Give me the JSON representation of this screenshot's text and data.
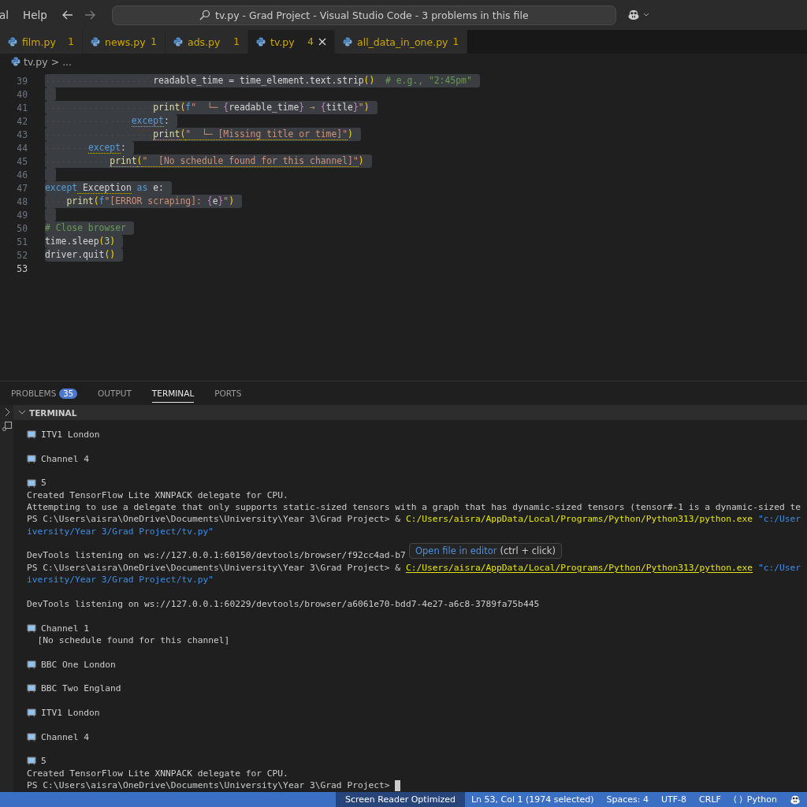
{
  "menu": [
    "al",
    "Help"
  ],
  "command_center": {
    "title": "tv.py - Grad Project - Visual Studio Code - 3 problems in this file"
  },
  "tabs": [
    {
      "label": "film.py",
      "problems": "1",
      "selected": false
    },
    {
      "label": "news.py",
      "problems": "1",
      "selected": false
    },
    {
      "label": "ads.py",
      "problems": "1",
      "selected": false
    },
    {
      "label": "tv.py",
      "problems": "4",
      "selected": true
    },
    {
      "label": "all_data_in_one.py",
      "problems": "1",
      "selected": false
    }
  ],
  "breadcrumb": {
    "file": "tv.py",
    "sep": ">",
    "rest": "..."
  },
  "editor": {
    "lines": [
      {
        "number": "39",
        "selected": true,
        "tokens": [
          {
            "kind": "plain",
            "text": "                    readable_time = time_element.text.strip"
          },
          {
            "kind": "paren",
            "text": "()"
          },
          {
            "kind": "comment",
            "text": "  # e.g., \"2:45pm\""
          }
        ]
      },
      {
        "number": "40",
        "selected": true
      },
      {
        "number": "41",
        "selected": true,
        "tokens": [
          {
            "kind": "func",
            "text": "                    print"
          },
          {
            "kind": "paren",
            "text": "("
          },
          {
            "kind": "keyword",
            "text": "f"
          },
          {
            "kind": "string",
            "text": "\"  └─ "
          },
          {
            "kind": "brace",
            "text": "{"
          },
          {
            "kind": "plain",
            "text": "readable_time"
          },
          {
            "kind": "brace",
            "text": "}"
          },
          {
            "kind": "string",
            "text": " → "
          },
          {
            "kind": "brace",
            "text": "{"
          },
          {
            "kind": "plain",
            "text": "title"
          },
          {
            "kind": "brace",
            "text": "}"
          },
          {
            "kind": "string",
            "text": "\""
          },
          {
            "kind": "paren",
            "text": ")"
          }
        ]
      },
      {
        "number": "42",
        "selected": true,
        "tokens": [
          {
            "kind": "keyword",
            "text": "                except",
            "warn": true
          },
          {
            "kind": "plain",
            "text": ":"
          }
        ]
      },
      {
        "number": "43",
        "selected": true,
        "tokens": [
          {
            "kind": "func",
            "text": "                    print",
            "warn": true
          },
          {
            "kind": "paren",
            "text": "(",
            "warn": true
          },
          {
            "kind": "string",
            "text": "\"  └─ [Missing title or time]\"",
            "warn": true
          },
          {
            "kind": "paren",
            "text": ")"
          }
        ]
      },
      {
        "number": "44",
        "selected": true,
        "tokens": [
          {
            "kind": "keyword",
            "text": "        except",
            "warn": true
          },
          {
            "kind": "plain",
            "text": ":"
          }
        ]
      },
      {
        "number": "45",
        "selected": true,
        "tokens": [
          {
            "kind": "func",
            "text": "            print",
            "warn": true
          },
          {
            "kind": "paren",
            "text": "(",
            "warn": true
          },
          {
            "kind": "string",
            "text": "\"  [No schedule found for this channel]\"",
            "warn": true
          },
          {
            "kind": "paren",
            "text": ")"
          }
        ]
      },
      {
        "number": "46",
        "selected": true
      },
      {
        "number": "47",
        "selected": true,
        "tokens": [
          {
            "kind": "keyword",
            "text": "except"
          },
          {
            "kind": "plain",
            "text": " Exception",
            "warn": true
          },
          {
            "kind": "keyword",
            "text": " as"
          },
          {
            "kind": "plain",
            "text": " e:"
          }
        ]
      },
      {
        "number": "48",
        "selected": true,
        "tokens": [
          {
            "kind": "func",
            "text": "    print"
          },
          {
            "kind": "paren",
            "text": "("
          },
          {
            "kind": "keyword",
            "text": "f"
          },
          {
            "kind": "string",
            "text": "\"[ERROR scraping]: "
          },
          {
            "kind": "brace",
            "text": "{"
          },
          {
            "kind": "plain",
            "text": "e"
          },
          {
            "kind": "brace",
            "text": "}"
          },
          {
            "kind": "string",
            "text": "\""
          },
          {
            "kind": "paren",
            "text": ")"
          }
        ]
      },
      {
        "number": "49",
        "selected": true
      },
      {
        "number": "50",
        "selected": true,
        "tokens": [
          {
            "kind": "comment",
            "text": "# Close browser"
          }
        ]
      },
      {
        "number": "51",
        "selected": true,
        "tokens": [
          {
            "kind": "plain",
            "text": "time.sleep"
          },
          {
            "kind": "paren",
            "text": "("
          },
          {
            "kind": "number",
            "text": "3"
          },
          {
            "kind": "paren",
            "text": ")"
          }
        ]
      },
      {
        "number": "52",
        "selected": true,
        "tokens": [
          {
            "kind": "plain",
            "text": "driver.quit"
          },
          {
            "kind": "paren",
            "text": "()"
          }
        ]
      },
      {
        "number": "53",
        "selected": false,
        "current": true
      }
    ]
  },
  "panel_tabs": [
    {
      "label": "PROBLEMS",
      "badge": "35",
      "selected": false
    },
    {
      "label": "OUTPUT",
      "selected": false
    },
    {
      "label": "TERMINAL",
      "selected": true
    },
    {
      "label": "PORTS",
      "selected": false
    }
  ],
  "terminal": {
    "header": "TERMINAL",
    "lines": [
      {
        "kind": "channel",
        "text": "ITV1 London"
      },
      {
        "kind": "blank"
      },
      {
        "kind": "channel",
        "text": "Channel 4"
      },
      {
        "kind": "blank"
      },
      {
        "kind": "channel",
        "text": "5"
      },
      {
        "kind": "text",
        "text": "Created TensorFlow Lite XNNPACK delegate for CPU."
      },
      {
        "kind": "text",
        "text": "Attempting to use a delegate that only supports static-sized tensors with a graph that has dynamic-sized tensors (tensor#-1 is a dynamic-sized te"
      },
      {
        "kind": "prompt",
        "prompt": "PS C:\\Users\\aisra\\OneDrive\\Documents\\University\\Year 3\\Grad Project> & ",
        "exe": "C:/Users/aisra/AppData/Local/Programs/Python/Python313/python.exe",
        "arg": " \"c:/User",
        "hovered": false
      },
      {
        "kind": "path",
        "text": "iversity/Year 3/Grad Project/tv.py\""
      },
      {
        "kind": "blank"
      },
      {
        "kind": "text",
        "text": "DevTools listening on ws://127.0.0.1:60150/devtools/browser/f92cc4ad-b7"
      },
      {
        "kind": "prompt",
        "prompt": "PS C:\\Users\\aisra\\OneDrive\\Documents\\University\\Year 3\\Grad Project> & ",
        "exe": "C:/Users/aisra/AppData/Local/Programs/Python/Python313/python.exe",
        "arg": " \"c:/User",
        "hovered": true
      },
      {
        "kind": "path",
        "text": "iversity/Year 3/Grad Project/tv.py\""
      },
      {
        "kind": "blank"
      },
      {
        "kind": "text",
        "text": "DevTools listening on ws://127.0.0.1:60229/devtools/browser/a6061e70-bdd7-4e27-a6c8-3789fa75b445"
      },
      {
        "kind": "blank"
      },
      {
        "kind": "channel",
        "text": "Channel 1"
      },
      {
        "kind": "text",
        "text": "  [No schedule found for this channel]"
      },
      {
        "kind": "blank"
      },
      {
        "kind": "channel",
        "text": "BBC One London"
      },
      {
        "kind": "blank"
      },
      {
        "kind": "channel",
        "text": "BBC Two England"
      },
      {
        "kind": "blank"
      },
      {
        "kind": "channel",
        "text": "ITV1 London"
      },
      {
        "kind": "blank"
      },
      {
        "kind": "channel",
        "text": "Channel 4"
      },
      {
        "kind": "blank"
      },
      {
        "kind": "channel",
        "text": "5"
      },
      {
        "kind": "text",
        "text": "Created TensorFlow Lite XNNPACK delegate for CPU."
      },
      {
        "kind": "prompt",
        "prompt": "PS C:\\Users\\aisra\\OneDrive\\Documents\\University\\Year 3\\Grad Project>",
        "cursor": true
      }
    ]
  },
  "tooltip": {
    "link": "Open file in editor",
    "hint": "(ctrl + click)"
  },
  "status_bar": [
    {
      "kind": "mode",
      "text": "Screen Reader Optimized"
    },
    {
      "kind": "item",
      "text": "Ln 53, Col 1 (1974 selected)"
    },
    {
      "kind": "item",
      "text": "Spaces: 4"
    },
    {
      "kind": "item",
      "text": "UTF-8"
    },
    {
      "kind": "item",
      "text": "CRLF"
    },
    {
      "kind": "lang",
      "text": "Python"
    },
    {
      "kind": "copilot"
    }
  ]
}
